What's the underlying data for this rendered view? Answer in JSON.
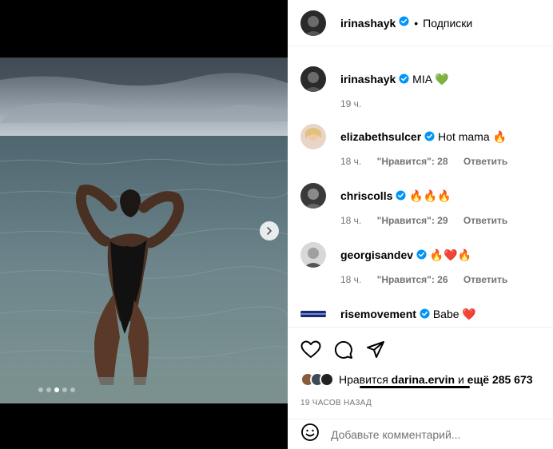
{
  "post": {
    "author": "irinashayk",
    "follow_label": "Подписки",
    "separator": "•"
  },
  "caption": {
    "author": "irinashayk",
    "text": "MIA 💚",
    "time": "19 ч."
  },
  "comments": [
    {
      "author": "elizabethsulcer",
      "text": "Hot mama 🔥",
      "time": "18 ч.",
      "likes": "\"Нравится\": 28",
      "reply": "Ответить"
    },
    {
      "author": "chriscolls",
      "text": "🔥🔥🔥",
      "time": "18 ч.",
      "likes": "\"Нравится\": 29",
      "reply": "Ответить"
    },
    {
      "author": "georgisandev",
      "text": "🔥❤️🔥",
      "time": "18 ч.",
      "likes": "\"Нравится\": 26",
      "reply": "Ответить"
    },
    {
      "author": "risemovement",
      "text": "Babe ❤️"
    }
  ],
  "likes": {
    "prefix": "Нравится",
    "user": "darina.ervin",
    "joiner": "и",
    "rest": "ещё 285 673"
  },
  "posted_time": "19 ЧАСОВ НАЗАД",
  "add_comment": {
    "placeholder": "Добавьте комментарий..."
  },
  "icons": {
    "like": "heart-icon",
    "comment": "comment-icon",
    "share": "share-icon",
    "emoji": "emoji-icon",
    "verified": "verified-badge-icon",
    "next": "chevron-right-icon"
  },
  "colors": {
    "verified": "#0095f6",
    "muted": "#737373"
  },
  "carousel": {
    "slides": 5,
    "active": 2
  }
}
